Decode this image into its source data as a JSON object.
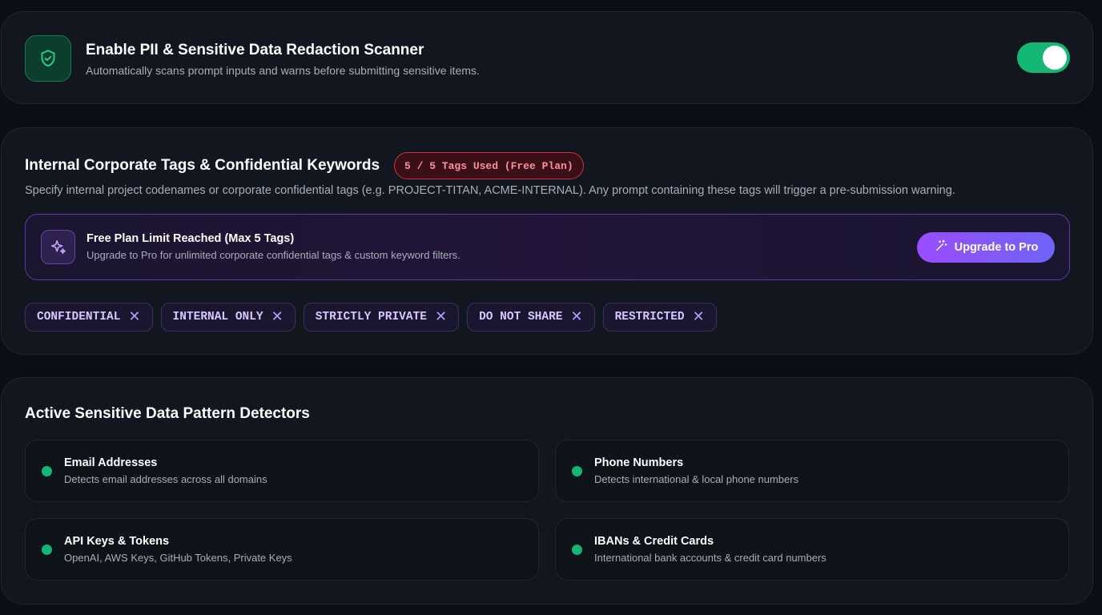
{
  "scanner": {
    "title": "Enable PII & Sensitive Data Redaction Scanner",
    "subtitle": "Automatically scans prompt inputs and warns before submitting sensitive items.",
    "enabled": true,
    "icon": "shield-check-icon"
  },
  "tags_section": {
    "title": "Internal Corporate Tags & Confidential Keywords",
    "usage_badge": "5 / 5 Tags Used (Free Plan)",
    "description": "Specify internal project codenames or corporate confidential tags (e.g. PROJECT-TITAN, ACME-INTERNAL). Any prompt containing these tags will trigger a pre-submission warning.",
    "promo": {
      "icon": "sparkles-icon",
      "title": "Free Plan Limit Reached (Max 5 Tags)",
      "subtitle": "Upgrade to Pro for unlimited corporate confidential tags & custom keyword filters.",
      "button_label": "Upgrade to Pro"
    },
    "tags": [
      {
        "label": "CONFIDENTIAL"
      },
      {
        "label": "INTERNAL ONLY"
      },
      {
        "label": "STRICTLY PRIVATE"
      },
      {
        "label": "DO NOT SHARE"
      },
      {
        "label": "RESTRICTED"
      }
    ],
    "remove_glyph": "✕"
  },
  "detectors_section": {
    "title": "Active Sensitive Data Pattern Detectors",
    "detectors": [
      {
        "title": "Email Addresses",
        "subtitle": "Detects email addresses across all domains",
        "active": true
      },
      {
        "title": "Phone Numbers",
        "subtitle": "Detects international & local phone numbers",
        "active": true
      },
      {
        "title": "API Keys & Tokens",
        "subtitle": "OpenAI, AWS Keys, GitHub Tokens, Private Keys",
        "active": true
      },
      {
        "title": "IBANs & Credit Cards",
        "subtitle": "International bank accounts & credit card numbers",
        "active": true
      }
    ]
  },
  "colors": {
    "accent_green": "#14b874",
    "accent_purple": "#9a4dff",
    "danger_red": "#c73344"
  }
}
